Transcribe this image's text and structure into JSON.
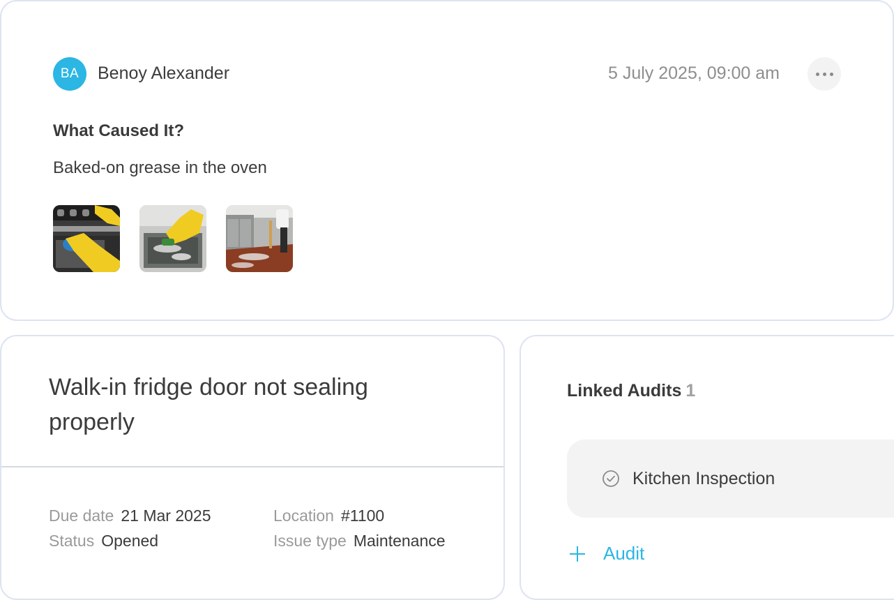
{
  "comment": {
    "author_initials": "BA",
    "author_name": "Benoy Alexander",
    "timestamp": "5 July 2025, 09:00 am",
    "question": "What Caused It?",
    "answer": "Baked-on grease in the oven",
    "attachments": [
      "oven-cleaning-photo",
      "sink-scrubbing-photo",
      "kitchen-floor-cleaning-photo"
    ]
  },
  "issue": {
    "title": "Walk-in fridge door not sealing properly",
    "fields": {
      "due_date_label": "Due date",
      "due_date": "21 Mar 2025",
      "location_label": "Location",
      "location": "#1100",
      "status_label": "Status",
      "status": "Opened",
      "issue_type_label": "Issue type",
      "issue_type": "Maintenance"
    }
  },
  "linked_audits": {
    "heading": "Linked Audits",
    "count": "1",
    "items": [
      {
        "name": "Kitchen Inspection",
        "icon": "check-circle-icon"
      }
    ],
    "add_label": "Audit"
  },
  "colors": {
    "accent": "#2bb6e4",
    "border": "#dde3f1",
    "muted": "#9a9a9a"
  }
}
